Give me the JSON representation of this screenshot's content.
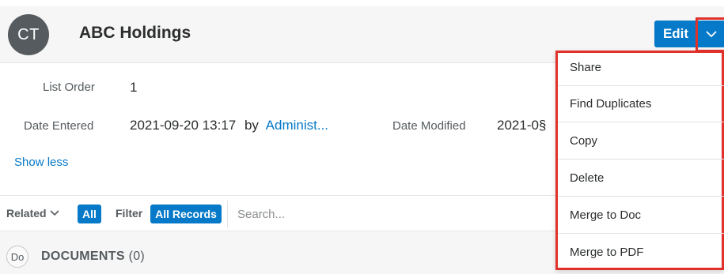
{
  "record": {
    "avatar_initials": "CT",
    "title": "ABC Holdings",
    "edit_label": "Edit"
  },
  "fields": {
    "list_order_label": "List Order",
    "list_order_value": "1",
    "date_entered_label": "Date Entered",
    "date_entered_value": "2021-09-20 13:17",
    "by_label": "by",
    "entered_by": "Administ...",
    "date_modified_label": "Date Modified",
    "date_modified_value": "2021-0§"
  },
  "show_less_label": "Show less",
  "subpanel": {
    "related_label": "Related",
    "all_label": "All",
    "filter_label": "Filter",
    "all_records_label": "All Records",
    "search_placeholder": "Search..."
  },
  "documents": {
    "badge": "Do",
    "title": "DOCUMENTS",
    "count": "(0)"
  },
  "actions_menu": {
    "items": [
      "Share",
      "Find Duplicates",
      "Copy",
      "Delete",
      "Merge to Doc",
      "Merge to PDF"
    ]
  },
  "colors": {
    "accent": "#0679c8",
    "highlight": "#e0322b"
  },
  "icons": {
    "caret": "chevron-down-icon",
    "related_caret": "chevron-down-icon"
  }
}
